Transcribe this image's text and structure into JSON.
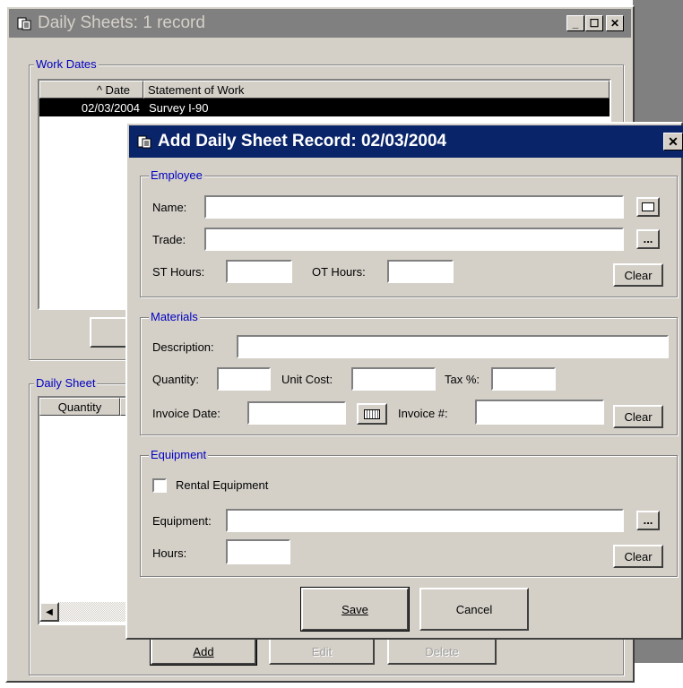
{
  "main_window": {
    "title": "Daily Sheets: 1 record",
    "work_dates": {
      "legend": "Work Dates",
      "columns": [
        "^ Date",
        "Statement of Work"
      ],
      "rows": [
        {
          "date": "02/03/2004",
          "statement": "Survey I-90"
        }
      ]
    },
    "daily_sheet": {
      "legend": "Daily Sheet",
      "columns": [
        "Quantity"
      ]
    },
    "buttons": {
      "add": "Add",
      "edit": "Edit",
      "delete": "Delete"
    }
  },
  "dialog": {
    "title": "Add Daily Sheet Record: 02/03/2004",
    "close_glyph": "✕",
    "employee": {
      "legend": "Employee",
      "name_label": "Name:",
      "name_value": "",
      "trade_label": "Trade:",
      "trade_value": "",
      "st_hours_label": "ST Hours:",
      "st_hours_value": "",
      "ot_hours_label": "OT Hours:",
      "ot_hours_value": "",
      "browse_label": "...",
      "clear_label": "Clear"
    },
    "materials": {
      "legend": "Materials",
      "description_label": "Description:",
      "description_value": "",
      "quantity_label": "Quantity:",
      "quantity_value": "",
      "unit_cost_label": "Unit Cost:",
      "unit_cost_value": "",
      "tax_label": "Tax %:",
      "tax_value": "",
      "invoice_date_label": "Invoice Date:",
      "invoice_date_value": "",
      "invoice_num_label": "Invoice #:",
      "invoice_num_value": "",
      "clear_label": "Clear"
    },
    "equipment": {
      "legend": "Equipment",
      "rental_label": "Rental Equipment",
      "rental_checked": false,
      "equipment_label": "Equipment:",
      "equipment_value": "",
      "hours_label": "Hours:",
      "hours_value": "",
      "browse_label": "...",
      "clear_label": "Clear"
    },
    "save_label": "Save",
    "cancel_label": "Cancel"
  }
}
